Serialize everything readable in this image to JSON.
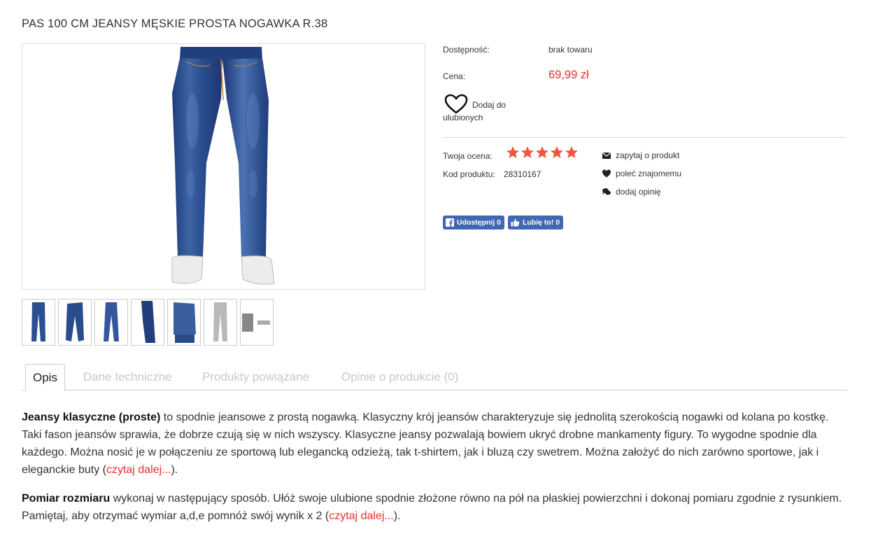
{
  "product": {
    "title": "PAS 100 CM JEANSY MĘSKIE PROSTA NOGAWKA R.38",
    "availability_label": "Dostępność:",
    "availability_value": "brak towaru",
    "price_label": "Cena:",
    "price_value": "69,99 zł",
    "favorite_label": "Dodaj do ulubionych",
    "rating_label": "Twoja ocena:",
    "rating_value": 5,
    "rating_max": 5,
    "code_label": "Kod produktu:",
    "code_value": "28310167"
  },
  "actions": [
    {
      "label": "zapytaj o produkt",
      "icon": "envelope-icon"
    },
    {
      "label": "poleć znajomemu",
      "icon": "heart-icon"
    },
    {
      "label": "dodaj opinię",
      "icon": "comments-icon"
    }
  ],
  "social": {
    "share_label": "Udostępnij 0",
    "like_label": "Lubię to! 0"
  },
  "tabs": [
    {
      "label": "Opis",
      "active": true
    },
    {
      "label": "Dane techniczne",
      "active": false
    },
    {
      "label": "Produkty powiązane",
      "active": false
    },
    {
      "label": "Opinie o produkcie (0)",
      "active": false
    }
  ],
  "description": {
    "p1_bold": "Jeansy klasyczne (proste)",
    "p1_text": " to spodnie jeansowe z prostą nogawką. Klasyczny krój jeansów charakteryzuje się jednolitą szerokością nogawki od kolana po kostkę. Taki fason jeansów sprawia, że dobrze czują się w nich wszyscy. Klasyczne jeansy pozwalają bowiem ukryć drobne mankamenty figury. To wygodne spodnie dla każdego. Można nosić je w połączeniu ze sportową lub elegancką odzieżą, tak t-shirtem, jak i bluzą czy swetrem. Można założyć do nich zarówno sportowe, jak i eleganckie buty (",
    "p1_link": "czytaj dalej...",
    "p1_end": ").",
    "p2_bold": "Pomiar rozmiaru",
    "p2_text": " wykonaj w następujący sposób. Ułóż swoje ulubione spodnie złożone równo na pół na płaskiej powierzchni i dokonaj pomiaru zgodnie z rysunkiem. Pamiętaj, aby otrzymać wymiar a,d,e pomnóż swój wynik x 2 (",
    "p2_link": "czytaj dalej...",
    "p2_end": ")."
  },
  "colors": {
    "accent": "#e8302a",
    "star": "#f0553e",
    "facebook": "#4267b2"
  }
}
